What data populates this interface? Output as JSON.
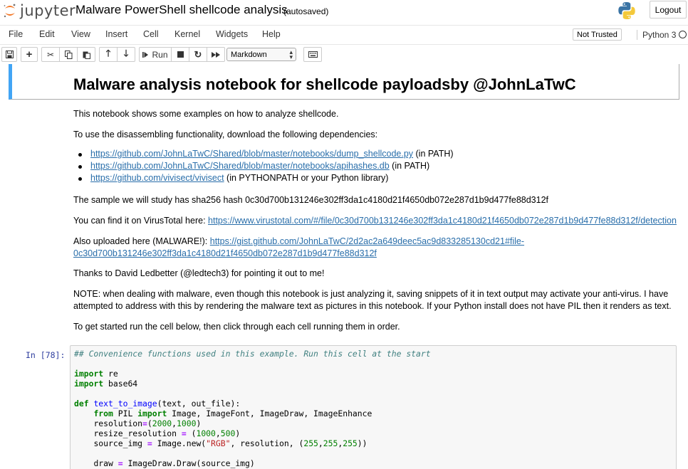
{
  "header": {
    "logo_text": "jupyter",
    "notebook_title": "Malware PowerShell shellcode analysis",
    "autosave_status": "(autosaved)",
    "logout_label": "Logout"
  },
  "menubar": {
    "items": [
      "File",
      "Edit",
      "View",
      "Insert",
      "Cell",
      "Kernel",
      "Widgets",
      "Help"
    ],
    "trust_label": "Not Trusted",
    "kernel_name": "Python 3"
  },
  "toolbar": {
    "run_label": "Run",
    "cell_type": "Markdown"
  },
  "markdown": {
    "title": "Malware analysis notebook for shellcode payloadsby @JohnLaTwC",
    "intro": "This notebook shows some examples on how to analyze shellcode.",
    "deps_intro": "To use the disassembling functionality, download the following dependencies:",
    "deps": [
      {
        "link": "https://github.com/JohnLaTwC/Shared/blob/master/notebooks/dump_shellcode.py",
        "note": " (in PATH)"
      },
      {
        "link": "https://github.com/JohnLaTwC/Shared/blob/master/notebooks/apihashes.db",
        "note": " (in PATH)"
      },
      {
        "link": "https://github.com/vivisect/vivisect",
        "note": " (in PYTHONPATH or your Python library)"
      }
    ],
    "sample_hash": "The sample we will study has sha256 hash 0c30d700b131246e302ff3da1c4180d21f4650db072e287d1b9d477fe88d312f",
    "vt_prefix": "You can find it on VirusTotal here: ",
    "vt_link": "https://www.virustotal.com/#/file/0c30d700b131246e302ff3da1c4180d21f4650db072e287d1b9d477fe88d312f/detection",
    "gist_prefix": "Also uploaded here (MALWARE!): ",
    "gist_link_1": "https://gist.github.com/JohnLaTwC/2d2ac2a649deec5ac9d833285130cd21#file-",
    "gist_link_2": "0c30d700b131246e302ff3da1c4180d21f4650db072e287d1b9d477fe88d312f",
    "thanks": "Thanks to David Ledbetter (@ledtech3) for pointing it out to me!",
    "note_1": "NOTE: when dealing with malware, even though this notebook is just analyzing it, saving snippets of it in text output may activate your anti-virus. I have",
    "note_2": "attempted to address with this by rendering the malware text as pictures in this notebook. If your Python install does not have PIL then it renders as text.",
    "get_started": "To get started run the cell below, then click through each cell running them in order."
  },
  "code_cell": {
    "prompt": "In [78]:",
    "comment": "## Convenience functions used in this example. Run this cell at the start",
    "import_kw": "import",
    "mod_re": " re",
    "mod_b64": " base64",
    "def_kw": "def",
    "fn_name": "text_to_image",
    "fn_args": "(text, out_file):",
    "from_kw": "from",
    "pil_mod": " PIL ",
    "import_kw2": "import",
    "pil_names": " Image, ImageFont, ImageDraw, ImageEnhance",
    "res_name": "resolution",
    "res_eq": "=",
    "res_open": "(",
    "n2000": "2000",
    "comma": ",",
    "n1000": "1000",
    "res_close": ")",
    "rres_name": "resize_resolution ",
    "rres_eq": "=",
    "rres_open": " (",
    "n1000b": "1000",
    "n500": "500",
    "src_name": "source_img ",
    "src_eq": "=",
    "src_call": " Image.new(",
    "rgb": "\"RGB\"",
    "src_mid": ", resolution, (",
    "n255a": "255",
    "n255b": "255",
    "n255c": "255",
    "src_close": "))",
    "draw_name": "draw ",
    "draw_eq": "=",
    "draw_call": " ImageDraw.Draw(source_img)"
  }
}
